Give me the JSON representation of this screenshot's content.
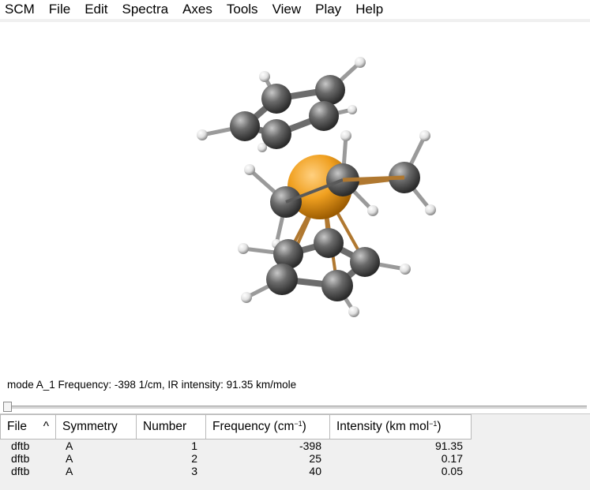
{
  "menu": [
    "SCM",
    "File",
    "Edit",
    "Spectra",
    "Axes",
    "Tools",
    "View",
    "Play",
    "Help"
  ],
  "status": "mode A_1 Frequency: -398 1/cm, IR intensity:  91.35 km/mole",
  "table": {
    "headers": {
      "file": "File",
      "sort_glyph": "^",
      "symmetry": "Symmetry",
      "number": "Number",
      "frequency": "Frequency (cm",
      "frequency_sup": "−1",
      "frequency_close": ")",
      "intensity": "Intensity (km mol",
      "intensity_sup": "−1",
      "intensity_close": ")"
    },
    "rows": [
      {
        "file": "dftb",
        "symmetry": "A",
        "number": "1",
        "frequency": "-398",
        "intensity": "91.35"
      },
      {
        "file": "dftb",
        "symmetry": "A",
        "number": "2",
        "frequency": "25",
        "intensity": "0.17"
      },
      {
        "file": "dftb",
        "symmetry": "A",
        "number": "3",
        "frequency": "40",
        "intensity": "0.05"
      }
    ]
  },
  "colors": {
    "metal": "#f0a020",
    "carbon": "#5a5a5a",
    "hydrogen": "#f0f0f0",
    "bond_metal": "#b07830"
  }
}
